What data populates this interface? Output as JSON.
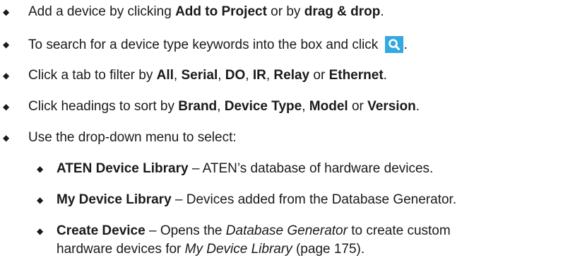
{
  "bullet_glyph": "◆",
  "items": [
    {
      "segments": [
        {
          "t": "Add a device by clicking "
        },
        {
          "t": "Add to Project",
          "b": true
        },
        {
          "t": " or by "
        },
        {
          "t": "drag & drop",
          "b": true
        },
        {
          "t": "."
        }
      ]
    },
    {
      "segments": [
        {
          "t": "To search for a device type keywords into the box and click "
        },
        {
          "icon": "search-icon"
        },
        {
          "t": "."
        }
      ]
    },
    {
      "segments": [
        {
          "t": "Click a tab to filter by "
        },
        {
          "t": "All",
          "b": true
        },
        {
          "t": ", "
        },
        {
          "t": "Serial",
          "b": true
        },
        {
          "t": ", "
        },
        {
          "t": "DO",
          "b": true
        },
        {
          "t": ", "
        },
        {
          "t": "IR",
          "b": true
        },
        {
          "t": ", "
        },
        {
          "t": "Relay",
          "b": true
        },
        {
          "t": " or "
        },
        {
          "t": "Ethernet",
          "b": true
        },
        {
          "t": "."
        }
      ]
    },
    {
      "segments": [
        {
          "t": "Click headings to sort by "
        },
        {
          "t": "Brand",
          "b": true
        },
        {
          "t": ", "
        },
        {
          "t": "Device Type",
          "b": true
        },
        {
          "t": ", "
        },
        {
          "t": "Model",
          "b": true
        },
        {
          "t": " or "
        },
        {
          "t": "Version",
          "b": true
        },
        {
          "t": "."
        }
      ]
    },
    {
      "segments": [
        {
          "t": "Use the drop-down menu to select:"
        }
      ]
    }
  ],
  "subitems": [
    {
      "segments": [
        {
          "t": "ATEN Device Library",
          "b": true
        },
        {
          "t": " – ATEN’s database of hardware devices."
        }
      ]
    },
    {
      "segments": [
        {
          "t": "My Device Library",
          "b": true
        },
        {
          "t": " – Devices added from the Database Generator."
        }
      ]
    },
    {
      "segments": [
        {
          "t": "Create Device",
          "b": true
        },
        {
          "t": " – Opens the "
        },
        {
          "t": "Database Generator",
          "i": true
        },
        {
          "t": " to create custom"
        }
      ],
      "continuation": [
        {
          "t": "hardware devices for "
        },
        {
          "t": "My Device Library",
          "i": true
        },
        {
          "t": " (page 175)."
        }
      ]
    }
  ],
  "colors": {
    "text": "#1a1a1a",
    "search_button_bg": "#35a8e0",
    "search_icon_fg": "#ffffff"
  }
}
